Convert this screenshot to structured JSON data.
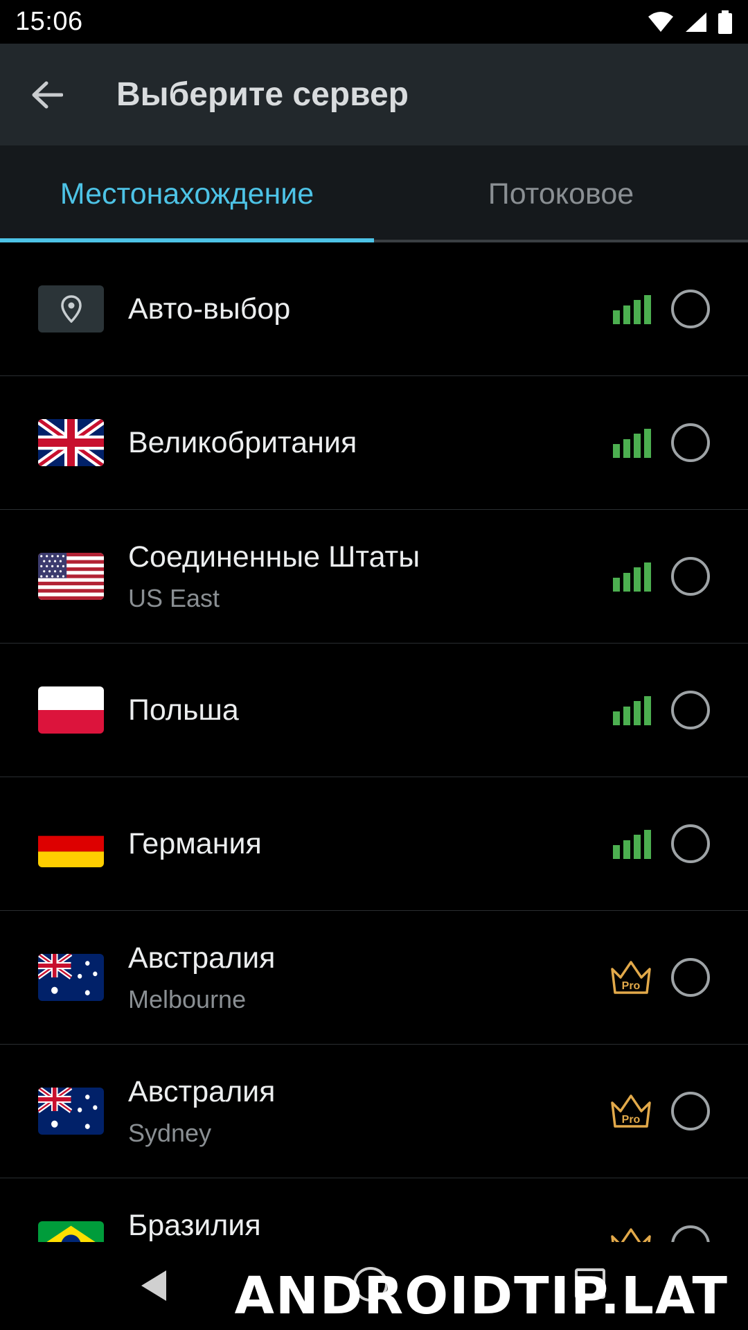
{
  "status_bar": {
    "time": "15:06"
  },
  "app_bar": {
    "title": "Выберите сервер"
  },
  "tabs": [
    {
      "label": "Местонахождение",
      "active": true
    },
    {
      "label": "Потоковое",
      "active": false
    }
  ],
  "servers": [
    {
      "name": "Авто-выбор",
      "sub": "",
      "flag": "location-pin-icon",
      "badge": "signal"
    },
    {
      "name": "Великобритания",
      "sub": "",
      "flag": "uk-flag",
      "badge": "signal"
    },
    {
      "name": "Соединенные Штаты",
      "sub": "US East",
      "flag": "us-flag",
      "badge": "signal"
    },
    {
      "name": "Польша",
      "sub": "",
      "flag": "poland-flag",
      "badge": "signal"
    },
    {
      "name": "Германия",
      "sub": "",
      "flag": "germany-flag",
      "badge": "signal"
    },
    {
      "name": "Австралия",
      "sub": "Melbourne",
      "flag": "australia-flag",
      "badge": "pro"
    },
    {
      "name": "Австралия",
      "sub": "Sydney",
      "flag": "australia-flag",
      "badge": "pro"
    },
    {
      "name": "Бразилия",
      "sub": "",
      "flag": "brazil-flag",
      "badge": "pro"
    }
  ],
  "pro_badge_text": "Pro",
  "colors": {
    "accent": "#4dc3e6",
    "signal": "#4caf50",
    "pro": "#e2a94a"
  },
  "watermark": "ANDROIDTIP.LAT"
}
